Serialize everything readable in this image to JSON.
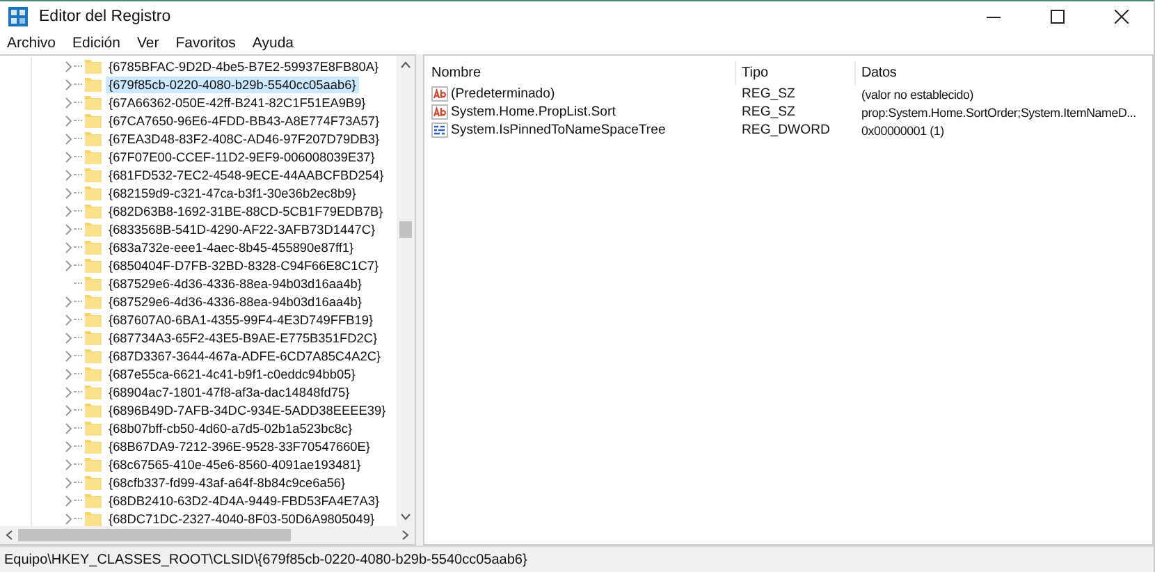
{
  "window": {
    "title": "Editor del Registro"
  },
  "menu": [
    "Archivo",
    "Edición",
    "Ver",
    "Favoritos",
    "Ayuda"
  ],
  "tree": {
    "items": [
      {
        "label": "{6785BFAC-9D2D-4be5-B7E2-59937E8FB80A}",
        "has_children": true,
        "selected": false
      },
      {
        "label": "{679f85cb-0220-4080-b29b-5540cc05aab6}",
        "has_children": true,
        "selected": true
      },
      {
        "label": "{67A66362-050E-42ff-B241-82C1F51EA9B9}",
        "has_children": true,
        "selected": false
      },
      {
        "label": "{67CA7650-96E6-4FDD-BB43-A8E774F73A57}",
        "has_children": true,
        "selected": false
      },
      {
        "label": "{67EA3D48-83F2-408C-AD46-97F207D79DB3}",
        "has_children": true,
        "selected": false
      },
      {
        "label": "{67F07E00-CCEF-11D2-9EF9-006008039E37}",
        "has_children": true,
        "selected": false
      },
      {
        "label": "{681FD532-7EC2-4548-9ECE-44AABCFBD254}",
        "has_children": true,
        "selected": false
      },
      {
        "label": "{682159d9-c321-47ca-b3f1-30e36b2ec8b9}",
        "has_children": true,
        "selected": false
      },
      {
        "label": "{682D63B8-1692-31BE-88CD-5CB1F79EDB7B}",
        "has_children": true,
        "selected": false
      },
      {
        "label": "{6833568B-541D-4290-AF22-3AFB73D1447C}",
        "has_children": true,
        "selected": false
      },
      {
        "label": "{683a732e-eee1-4aec-8b45-455890e87ff1}",
        "has_children": true,
        "selected": false
      },
      {
        "label": "{6850404F-D7FB-32BD-8328-C94F66E8C1C7}",
        "has_children": true,
        "selected": false
      },
      {
        "label": "{687529e6-4d36-4336-88ea-94b03d16aa4b}",
        "has_children": false,
        "selected": false
      },
      {
        "label": "{687529e6-4d36-4336-88ea-94b03d16aa4b}",
        "has_children": true,
        "selected": false
      },
      {
        "label": "{687607A0-6BA1-4355-99F4-4E3D749FFB19}",
        "has_children": true,
        "selected": false
      },
      {
        "label": "{687734A3-65F2-43E5-B9AE-E775B351FD2C}",
        "has_children": true,
        "selected": false
      },
      {
        "label": "{687D3367-3644-467a-ADFE-6CD7A85C4A2C}",
        "has_children": true,
        "selected": false
      },
      {
        "label": "{687e55ca-6621-4c41-b9f1-c0eddc94bb05}",
        "has_children": true,
        "selected": false
      },
      {
        "label": "{68904ac7-1801-47f8-af3a-dac14848fd75}",
        "has_children": true,
        "selected": false
      },
      {
        "label": "{6896B49D-7AFB-34DC-934E-5ADD38EEEE39}",
        "has_children": true,
        "selected": false
      },
      {
        "label": "{68b07bff-cb50-4d60-a7d5-02b1a523bc8c}",
        "has_children": true,
        "selected": false
      },
      {
        "label": "{68B67DA9-7212-396E-9528-33F70547660E}",
        "has_children": true,
        "selected": false
      },
      {
        "label": "{68c67565-410e-45e6-8560-4091ae193481}",
        "has_children": true,
        "selected": false
      },
      {
        "label": "{68cfb337-fd99-43af-a64f-8b84c9ce6a56}",
        "has_children": true,
        "selected": false
      },
      {
        "label": "{68DB2410-63D2-4D4A-9449-FBD53FA4E7A3}",
        "has_children": true,
        "selected": false
      },
      {
        "label": "{68DC71DC-2327-4040-8F03-50D6A9805049}",
        "has_children": true,
        "selected": false
      }
    ]
  },
  "values_table": {
    "columns": [
      "Nombre",
      "Tipo",
      "Datos"
    ],
    "rows": [
      {
        "kind": "string",
        "name": "(Predeterminado)",
        "type": "REG_SZ",
        "data": "(valor no establecido)"
      },
      {
        "kind": "string",
        "name": "System.Home.PropList.Sort",
        "type": "REG_SZ",
        "data": "prop:System.Home.SortOrder;System.ItemNameD..."
      },
      {
        "kind": "binary",
        "name": "System.IsPinnedToNameSpaceTree",
        "type": "REG_DWORD",
        "data": "0x00000001 (1)"
      }
    ]
  },
  "status_bar": "Equipo\\HKEY_CLASSES_ROOT\\CLSID\\{679f85cb-0220-4080-b29b-5540cc05aab6}"
}
